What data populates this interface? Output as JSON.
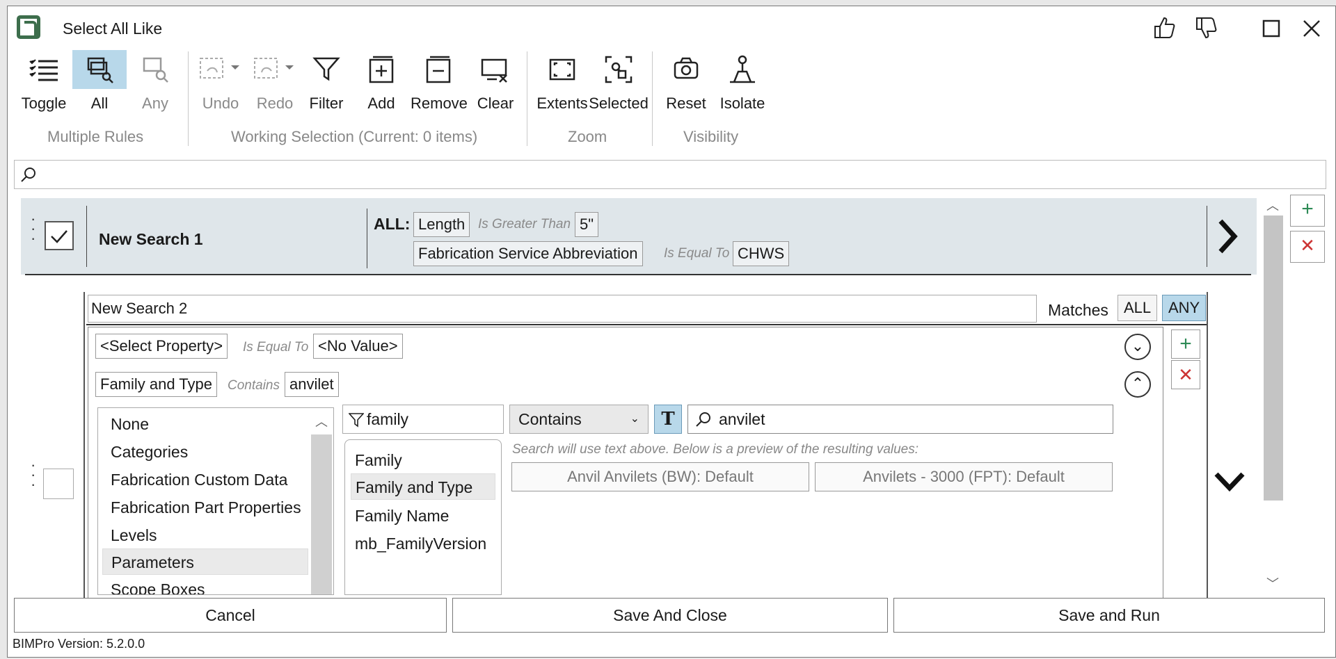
{
  "window": {
    "title": "Select All Like"
  },
  "ribbon": {
    "toggle": "Toggle",
    "all": "All",
    "any": "Any",
    "undo": "Undo",
    "redo": "Redo",
    "filter": "Filter",
    "add": "Add",
    "remove": "Remove",
    "clear": "Clear",
    "extents": "Extents",
    "selected": "Selected",
    "reset": "Reset",
    "isolate": "Isolate",
    "groups": {
      "multiple_rules": "Multiple Rules",
      "working_selection": "Working Selection (Current: 0 items)",
      "zoom": "Zoom",
      "visibility": "Visibility"
    }
  },
  "search": {
    "placeholder": ""
  },
  "rule1": {
    "name": "New Search 1",
    "mode": "ALL:",
    "conditions": [
      {
        "property": "Length",
        "operator": "Is Greater Than",
        "value": "5\""
      },
      {
        "property": "Fabrication Service Abbreviation",
        "operator": "Is Equal To",
        "value": "CHWS"
      }
    ]
  },
  "rule2": {
    "name": "New Search 2",
    "matches_label": "Matches",
    "all": "ALL",
    "any": "ANY",
    "conditions": [
      {
        "property": "<Select Property>",
        "operator": "Is Equal To",
        "value": "<No Value>"
      },
      {
        "property": "Family and Type",
        "operator": "Contains",
        "value": "anvilet"
      }
    ],
    "categories": [
      "None",
      "Categories",
      "Fabrication Custom Data",
      "Fabrication Part Properties",
      "Levels",
      "Parameters",
      "Scope Boxes"
    ],
    "filter_text": "family",
    "params": [
      "Family",
      "Family and Type",
      "Family Name",
      "mb_FamilyVersion"
    ],
    "operator_select": "Contains",
    "value_text": "anvilet",
    "hint": "Search will use text above. Below is a preview of the resulting values:",
    "preview": [
      "Anvil Anvilets (BW): Default",
      "Anvilets - 3000 (FPT): Default"
    ]
  },
  "footer": {
    "cancel": "Cancel",
    "save_close": "Save And Close",
    "save_run": "Save and Run",
    "version": "BIMPro Version: 5.2.0.0"
  }
}
